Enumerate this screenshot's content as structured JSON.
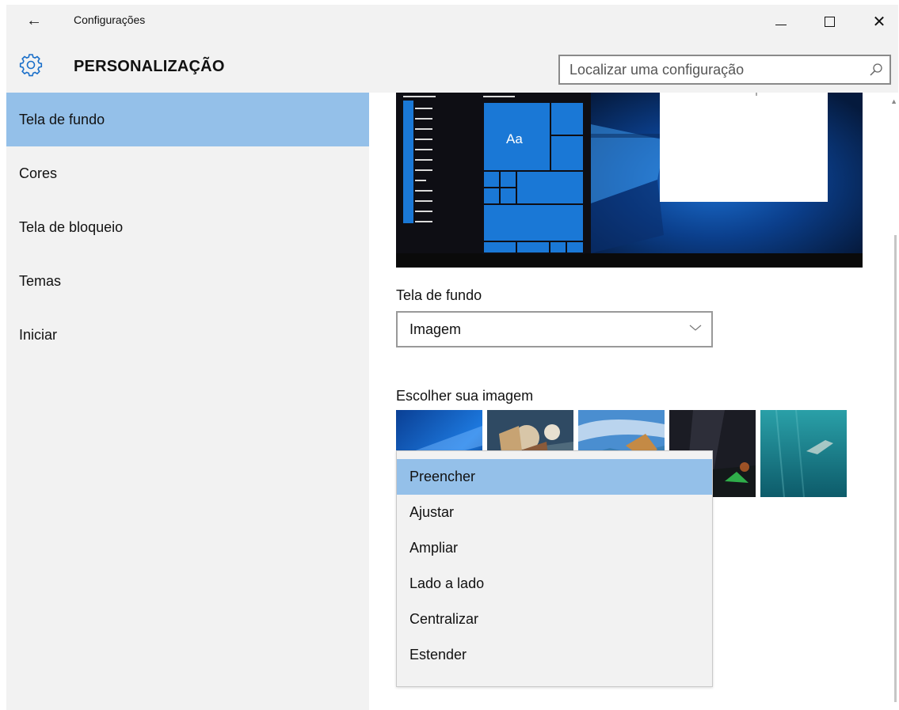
{
  "window": {
    "title": "Configurações",
    "controls": {
      "minimize": "minimize-icon",
      "maximize": "maximize-icon",
      "close": "close-icon"
    }
  },
  "header": {
    "title": "PERSONALIZAÇÃO",
    "icon": "gear-icon",
    "search": {
      "placeholder": "Localizar uma configuração",
      "value": "",
      "icon": "search-icon"
    }
  },
  "sidebar": {
    "items": [
      {
        "label": "Tela de fundo",
        "active": true
      },
      {
        "label": "Cores",
        "active": false
      },
      {
        "label": "Tela de bloqueio",
        "active": false
      },
      {
        "label": "Temas",
        "active": false
      },
      {
        "label": "Iniciar",
        "active": false
      }
    ]
  },
  "preview": {
    "tile_label": "Aa"
  },
  "background": {
    "label": "Tela de fundo",
    "selected": "Imagem"
  },
  "choose_image": {
    "label": "Escolher sua imagem",
    "thumbnails": [
      "windows-blue-wallpaper",
      "fantasy-characters",
      "coastal-rocks",
      "night-sky-tent",
      "underwater-swimmer"
    ]
  },
  "fit_dropdown": {
    "options": [
      {
        "label": "Preencher",
        "selected": true
      },
      {
        "label": "Ajustar",
        "selected": false
      },
      {
        "label": "Ampliar",
        "selected": false
      },
      {
        "label": "Lado a lado",
        "selected": false
      },
      {
        "label": "Centralizar",
        "selected": false
      },
      {
        "label": "Estender",
        "selected": false
      }
    ]
  },
  "colors": {
    "accent": "#94c0e9",
    "tile_blue": "#1a78d6",
    "chrome": "#f2f2f2"
  }
}
